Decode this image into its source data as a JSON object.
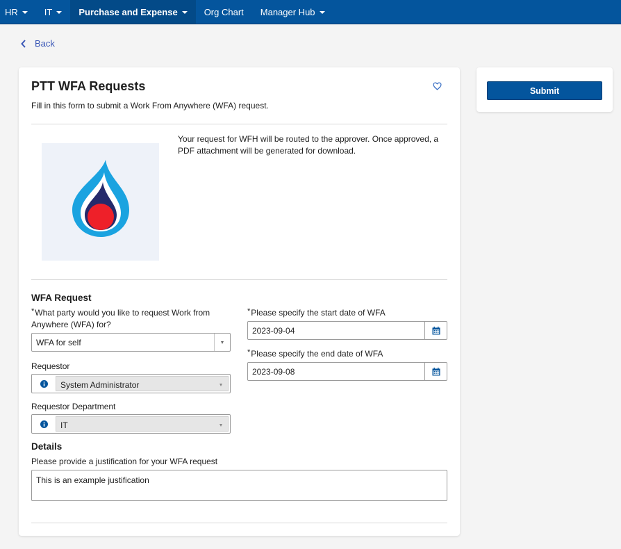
{
  "nav": {
    "items": [
      {
        "label": "HR",
        "dropdown": true
      },
      {
        "label": "IT",
        "dropdown": true
      },
      {
        "label": "Purchase and Expense",
        "dropdown": true,
        "active": true
      },
      {
        "label": "Org Chart",
        "dropdown": false
      },
      {
        "label": "Manager Hub",
        "dropdown": true
      }
    ]
  },
  "back_label": "Back",
  "form": {
    "title": "PTT WFA Requests",
    "subtitle": "Fill in this form to submit a Work From Anywhere (WFA) request.",
    "routing_text": "Your request for WFH will be routed to the approver.  Once approved, a PDF attachment will be generated for download.",
    "section_request": "WFA Request",
    "party_label": "What party would you like to request Work from Anywhere (WFA) for?",
    "party_value": "WFA for self",
    "requestor_label": "Requestor",
    "requestor_value": "System Administrator",
    "department_label": "Requestor Department",
    "department_value": "IT",
    "start_label": "Please specify the start date of WFA",
    "start_value": "2023-09-04",
    "end_label": "Please specify the end date of WFA",
    "end_value": "2023-09-08",
    "section_details": "Details",
    "justification_label": "Please provide a justification for your WFA request",
    "justification_value": "This is an example justification",
    "required_marker": "*"
  },
  "submit_label": "Submit",
  "colors": {
    "brand": "#04559d",
    "logo_outer": "#1aa3e0",
    "logo_mid": "#252a6b",
    "logo_core": "#ee2029"
  },
  "icons": {
    "favorite": "heart-outline-icon",
    "calendar": "calendar-icon",
    "info": "info-icon",
    "back": "chevron-left-icon"
  }
}
